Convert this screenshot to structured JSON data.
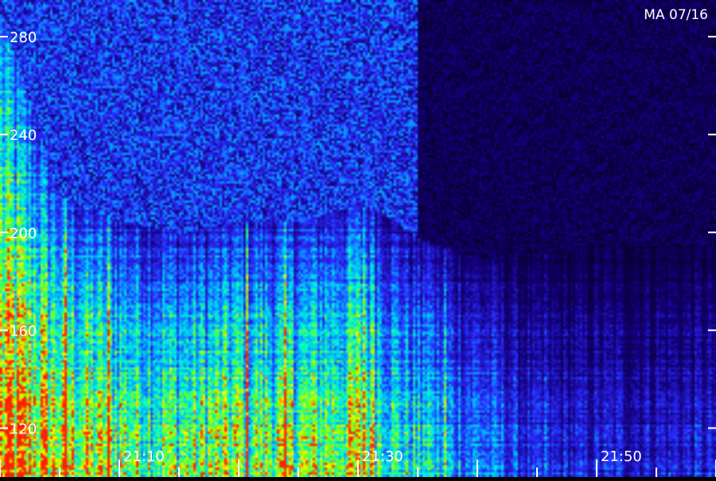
{
  "chart_data": {
    "type": "heatmap",
    "title": "",
    "station_label": "MA 07/16",
    "xlabel": "",
    "ylabel": "",
    "xlim": [
      "21:00",
      "21:59"
    ],
    "ylim": [
      100,
      295
    ],
    "y_ticks": [
      {
        "value": 280,
        "label": "280"
      },
      {
        "value": 240,
        "label": "240"
      },
      {
        "value": 200,
        "label": "200"
      },
      {
        "value": 160,
        "label": "160"
      },
      {
        "value": 120,
        "label": "120"
      }
    ],
    "x_ticks": [
      {
        "value": "21:10",
        "label": "21:10"
      },
      {
        "value": "21:30",
        "label": "21:30"
      },
      {
        "value": "21:50",
        "label": "21:50"
      }
    ],
    "grid": false,
    "colormap": [
      "#000000",
      "#14007a",
      "#2a2aff",
      "#00b4ff",
      "#00ffd0",
      "#7aff00",
      "#ffff00",
      "#ff2000"
    ],
    "intensity_profile": {
      "time_minutes": [
        0,
        5,
        10,
        15,
        20,
        25,
        30,
        33,
        35,
        40,
        45,
        50,
        55,
        59
      ],
      "top_frequency": [
        290,
        215,
        205,
        200,
        205,
        205,
        212,
        205,
        198,
        190,
        192,
        195,
        195,
        195
      ],
      "strength": [
        0.95,
        0.85,
        0.75,
        0.7,
        0.75,
        0.7,
        0.8,
        0.6,
        0.5,
        0.4,
        0.25,
        0.25,
        0.25,
        0.25
      ]
    }
  }
}
